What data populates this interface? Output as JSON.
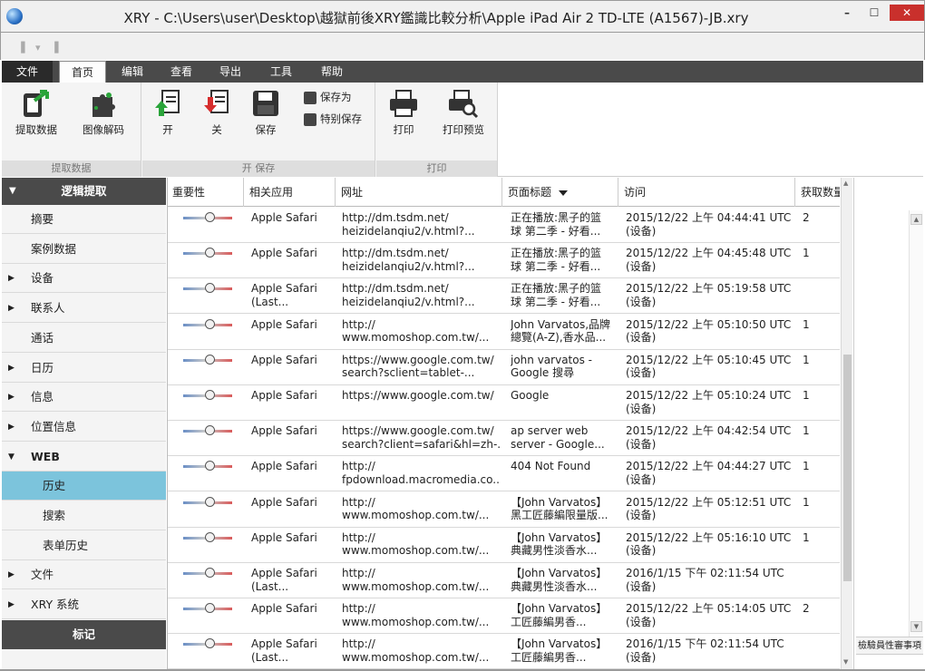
{
  "window": {
    "title": "XRY - C:\\Users\\user\\Desktop\\越獄前後XRY鑑識比較分析\\Apple iPad Air 2 TD-LTE (A1567)-JB.xry",
    "min_label": "–",
    "max_label": "☐",
    "close_label": "✕"
  },
  "menu": {
    "items": [
      "文件",
      "首页",
      "编辑",
      "查看",
      "导出",
      "工具",
      "帮助"
    ],
    "active": "首页"
  },
  "ribbon": {
    "groups": [
      {
        "label": "提取数据",
        "buttons": [
          "提取数据",
          "图像解码"
        ]
      },
      {
        "label": "开 保存",
        "buttons": [
          "开",
          "关",
          "保存"
        ],
        "small_buttons": [
          "保存为",
          "特别保存"
        ]
      },
      {
        "label": "打印",
        "buttons": [
          "打印",
          "打印预览"
        ]
      }
    ]
  },
  "sidebar": {
    "header": "逻辑提取",
    "items": [
      {
        "label": "摘要",
        "arrow": "",
        "level": 0
      },
      {
        "label": "案例数据",
        "arrow": "",
        "level": 0
      },
      {
        "label": "设备",
        "arrow": "▶",
        "level": 0
      },
      {
        "label": "联系人",
        "arrow": "▶",
        "level": 0
      },
      {
        "label": "通话",
        "arrow": "",
        "level": 0
      },
      {
        "label": "日历",
        "arrow": "▶",
        "level": 0
      },
      {
        "label": "信息",
        "arrow": "▶",
        "level": 0
      },
      {
        "label": "位置信息",
        "arrow": "▶",
        "level": 0
      },
      {
        "label": "WEB",
        "arrow": "▼",
        "level": 0
      },
      {
        "label": "历史",
        "arrow": "",
        "level": 1,
        "selected": true
      },
      {
        "label": "搜索",
        "arrow": "",
        "level": 1
      },
      {
        "label": "表单历史",
        "arrow": "",
        "level": 1
      },
      {
        "label": "文件",
        "arrow": "▶",
        "level": 0
      },
      {
        "label": "XRY 系统",
        "arrow": "▶",
        "level": 0
      }
    ],
    "footer": "标记"
  },
  "table": {
    "columns": [
      "重要性",
      "相关应用",
      "网址",
      "页面标题",
      "访问",
      "获取数量"
    ],
    "sorted_column": "页面标题",
    "rows": [
      {
        "app": [
          "Apple Safari",
          ""
        ],
        "url": [
          "http://dm.tsdm.net/",
          "heizidelanqiu2/v.html?..."
        ],
        "title": [
          "正在播放:黑子的篮",
          "球 第二季 - 好看..."
        ],
        "visit": [
          "2015/12/22 上午 04:44:41 UTC",
          "(设备)"
        ],
        "count": "2"
      },
      {
        "app": [
          "Apple Safari",
          ""
        ],
        "url": [
          "http://dm.tsdm.net/",
          "heizidelanqiu2/v.html?..."
        ],
        "title": [
          "正在播放:黑子的篮",
          "球 第二季 - 好看..."
        ],
        "visit": [
          "2015/12/22 上午 04:45:48 UTC",
          "(设备)"
        ],
        "count": "1"
      },
      {
        "app": [
          "Apple Safari",
          "(Last..."
        ],
        "url": [
          "http://dm.tsdm.net/",
          "heizidelanqiu2/v.html?..."
        ],
        "title": [
          "正在播放:黑子的篮",
          "球 第二季 - 好看..."
        ],
        "visit": [
          "2015/12/22 上午 05:19:58 UTC",
          "(设备)"
        ],
        "count": ""
      },
      {
        "app": [
          "Apple Safari",
          ""
        ],
        "url": [
          "http://",
          "www.momoshop.com.tw/..."
        ],
        "title": [
          "John Varvatos,品牌",
          "總覽(A-Z),香水品..."
        ],
        "visit": [
          "2015/12/22 上午 05:10:50 UTC",
          "(设备)"
        ],
        "count": "1"
      },
      {
        "app": [
          "Apple Safari",
          ""
        ],
        "url": [
          "https://www.google.com.tw/",
          "search?sclient=tablet-..."
        ],
        "title": [
          "john varvatos -",
          "Google 搜尋"
        ],
        "visit": [
          "2015/12/22 上午 05:10:45 UTC",
          "(设备)"
        ],
        "count": "1"
      },
      {
        "app": [
          "Apple Safari",
          ""
        ],
        "url": [
          "https://www.google.com.tw/",
          ""
        ],
        "title": [
          "Google",
          ""
        ],
        "visit": [
          "2015/12/22 上午 05:10:24 UTC",
          "(设备)"
        ],
        "count": "1"
      },
      {
        "app": [
          "Apple Safari",
          ""
        ],
        "url": [
          "https://www.google.com.tw/",
          "search?client=safari&hl=zh-..."
        ],
        "title": [
          "ap server web",
          "server - Google..."
        ],
        "visit": [
          "2015/12/22 上午 04:42:54 UTC",
          "(设备)"
        ],
        "count": "1"
      },
      {
        "app": [
          "Apple Safari",
          ""
        ],
        "url": [
          "http://",
          "fpdownload.macromedia.co..."
        ],
        "title": [
          "404 Not Found",
          ""
        ],
        "visit": [
          "2015/12/22 上午 04:44:27 UTC",
          "(设备)"
        ],
        "count": "1"
      },
      {
        "app": [
          "Apple Safari",
          ""
        ],
        "url": [
          "http://",
          "www.momoshop.com.tw/..."
        ],
        "title": [
          "【John Varvatos】",
          "黑工匠藤編限量版..."
        ],
        "visit": [
          "2015/12/22 上午 05:12:51 UTC",
          "(设备)"
        ],
        "count": "1"
      },
      {
        "app": [
          "Apple Safari",
          ""
        ],
        "url": [
          "http://",
          "www.momoshop.com.tw/..."
        ],
        "title": [
          "【John Varvatos】",
          "典藏男性淡香水..."
        ],
        "visit": [
          "2015/12/22 上午 05:16:10 UTC",
          "(设备)"
        ],
        "count": "1"
      },
      {
        "app": [
          "Apple Safari",
          "(Last..."
        ],
        "url": [
          "http://",
          "www.momoshop.com.tw/..."
        ],
        "title": [
          "【John Varvatos】",
          "典藏男性淡香水..."
        ],
        "visit": [
          "2016/1/15 下午 02:11:54 UTC",
          "(设备)"
        ],
        "count": ""
      },
      {
        "app": [
          "Apple Safari",
          ""
        ],
        "url": [
          "http://",
          "www.momoshop.com.tw/..."
        ],
        "title": [
          "【John Varvatos】",
          "工匠藤編男香..."
        ],
        "visit": [
          "2015/12/22 上午 05:14:05 UTC",
          "(设备)"
        ],
        "count": "2"
      },
      {
        "app": [
          "Apple Safari",
          "(Last..."
        ],
        "url": [
          "http://",
          "www.momoshop.com.tw/..."
        ],
        "title": [
          "【John Varvatos】",
          "工匠藤編男香..."
        ],
        "visit": [
          "2016/1/15 下午 02:11:54 UTC",
          "(设备)"
        ],
        "count": ""
      }
    ]
  },
  "right_panel": {
    "label": "檢驗員性審事項"
  },
  "colors": {
    "menubar": "#4a4a4a",
    "selected_item": "#7cc4dc",
    "close_button": "#c9302c"
  }
}
